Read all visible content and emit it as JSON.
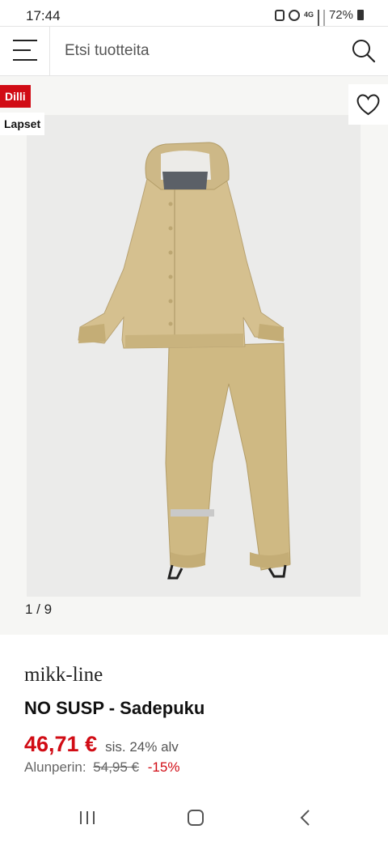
{
  "status_bar": {
    "time": "17:44",
    "network": "4G",
    "battery": "72%",
    "icons": [
      "notification-icon",
      "alarm-icon",
      "network-icon",
      "signal-icon",
      "signal-weak-icon",
      "battery-icon"
    ]
  },
  "search": {
    "placeholder": "Etsi tuotteita",
    "value": "",
    "icons": [
      "menu-icon",
      "search-icon"
    ]
  },
  "gallery": {
    "badge_deal": "Dilli",
    "badge_category": "Lapset",
    "counter": "1 / 9",
    "favorite_icon": "heart-icon",
    "image": "beige rain jacket and trousers set"
  },
  "product": {
    "brand": "mikk-line",
    "name": "NO SUSP - Sadepuku",
    "price": "46,71 €",
    "vat_note": "sis. 24% alv",
    "original_label": "Alunperin:",
    "original_price": "54,95 €",
    "discount": "-15%"
  },
  "colors": {
    "accent": "#d10c15",
    "product": "#d5c08f"
  },
  "navbar": {
    "icons": [
      "recent-apps-icon",
      "home-icon",
      "back-icon"
    ]
  }
}
